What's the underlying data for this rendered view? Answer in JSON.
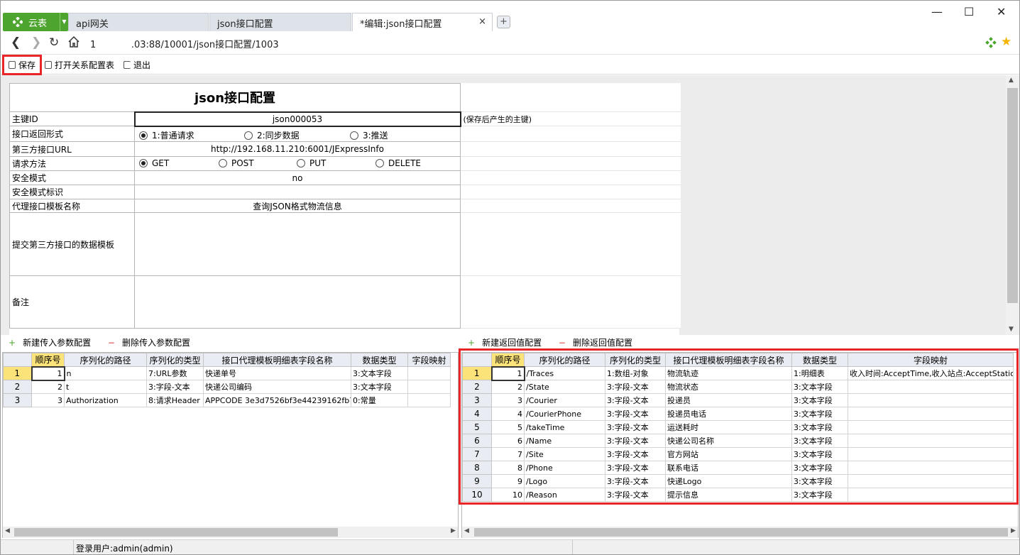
{
  "tabs": {
    "app_label": "云表",
    "items": [
      {
        "label": "api网关"
      },
      {
        "label": "json接口配置"
      },
      {
        "label": "*编辑:json接口配置"
      }
    ],
    "close_glyph": "×",
    "new_tab_glyph": "+"
  },
  "window_controls": {
    "minimize": "—",
    "maximize": "☐",
    "close": "✕"
  },
  "address": {
    "url": "1            .03:88/10001/json接口配置/1003"
  },
  "toolbar": {
    "save": "保存",
    "open_relation": "打开关系配置表",
    "exit": "退出"
  },
  "form": {
    "title": "json接口配置",
    "rows": {
      "pk_label": "主键ID",
      "pk_value": "json000053",
      "pk_note": "(保存后产生的主键)",
      "return_label": "接口返回形式",
      "return_opt1": "1:普通请求",
      "return_opt2": "2:同步数据",
      "return_opt3": "3:推送",
      "url_label": "第三方接口URL",
      "url_value": "http://192.168.11.210:6001/JExpressInfo",
      "method_label": "请求方法",
      "method_get": "GET",
      "method_post": "POST",
      "method_put": "PUT",
      "method_delete": "DELETE",
      "secure_label": "安全模式",
      "secure_value": "no",
      "secure_flag_label": "安全模式标识",
      "secure_flag_value": "",
      "proxy_label": "代理接口模板名称",
      "proxy_value": "查询JSON格式物流信息",
      "submit_label": "提交第三方接口的数据模板",
      "submit_value": "",
      "remark_label": "备注",
      "remark_value": ""
    }
  },
  "left_actions": {
    "add": "新建传入参数配置",
    "delete": "删除传入参数配置"
  },
  "right_actions": {
    "add": "新建返回值配置",
    "delete": "删除返回值配置"
  },
  "left_grid": {
    "headers": [
      "顺序号",
      "序列化的路径",
      "序列化的类型",
      "接口代理模板明细表字段名称",
      "数据类型",
      "字段映射"
    ],
    "rows": [
      [
        "1",
        "1",
        "n",
        "7:URL参数",
        "快递单号",
        "3:文本字段",
        ""
      ],
      [
        "2",
        "2",
        "t",
        "3:字段-文本",
        "快递公司编码",
        "3:文本字段",
        ""
      ],
      [
        "3",
        "3",
        "Authorization",
        "8:请求Header",
        "APPCODE 3e3d7526bf3e44239162fb7238",
        "0:常量",
        ""
      ]
    ]
  },
  "right_grid": {
    "headers": [
      "顺序号",
      "序列化的路径",
      "序列化的类型",
      "接口代理模板明细表字段名称",
      "数据类型",
      "字段映射"
    ],
    "rows": [
      [
        "1",
        "1",
        "/Traces",
        "1:数组-对象",
        "物流轨迹",
        "1:明细表",
        "收入时间:AcceptTime,收入站点:AcceptStation"
      ],
      [
        "2",
        "2",
        "/State",
        "3:字段-文本",
        "物流状态",
        "3:文本字段",
        ""
      ],
      [
        "3",
        "3",
        "/Courier",
        "3:字段-文本",
        "投递员",
        "3:文本字段",
        ""
      ],
      [
        "4",
        "4",
        "/CourierPhone",
        "3:字段-文本",
        "投递员电话",
        "3:文本字段",
        ""
      ],
      [
        "5",
        "5",
        "/takeTime",
        "3:字段-文本",
        "运送耗时",
        "3:文本字段",
        ""
      ],
      [
        "6",
        "6",
        "/Name",
        "3:字段-文本",
        "快递公司名称",
        "3:文本字段",
        ""
      ],
      [
        "7",
        "7",
        "/Site",
        "3:字段-文本",
        "官方网站",
        "3:文本字段",
        ""
      ],
      [
        "8",
        "8",
        "/Phone",
        "3:字段-文本",
        "联系电话",
        "3:文本字段",
        ""
      ],
      [
        "9",
        "9",
        "/Logo",
        "3:字段-文本",
        "快递Logo",
        "3:文本字段",
        ""
      ],
      [
        "10",
        "10",
        "/Reason",
        "3:字段-文本",
        "提示信息",
        "3:文本字段",
        ""
      ]
    ]
  },
  "status": {
    "user": "登录用户:admin(admin)"
  },
  "colors": {
    "brand_green": "#4da42f",
    "highlight_red": "#e8262a",
    "row_selected": "#fbe37a"
  }
}
